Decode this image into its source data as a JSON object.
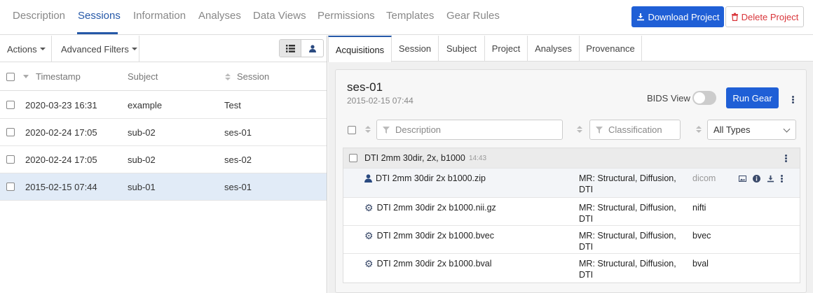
{
  "topnav": {
    "tabs": [
      "Description",
      "Sessions",
      "Information",
      "Analyses",
      "Data Views",
      "Permissions",
      "Templates",
      "Gear Rules"
    ],
    "active_tab": "Sessions",
    "download_label": "Download Project",
    "delete_label": "Delete Project",
    "accent": "#2558a8",
    "primary": "#1f5fd6",
    "danger": "#d9353a"
  },
  "left": {
    "actions_label": "Actions",
    "advanced_filters_label": "Advanced Filters",
    "columns": [
      "Timestamp",
      "Subject",
      "Session"
    ],
    "rows": [
      {
        "timestamp": "2020-03-23 16:31",
        "subject": "example",
        "session": "Test",
        "selected": false
      },
      {
        "timestamp": "2020-02-24 17:05",
        "subject": "sub-02",
        "session": "ses-01",
        "selected": false
      },
      {
        "timestamp": "2020-02-24 17:05",
        "subject": "sub-02",
        "session": "ses-02",
        "selected": false
      },
      {
        "timestamp": "2015-02-15 07:44",
        "subject": "sub-01",
        "session": "ses-01",
        "selected": true
      }
    ]
  },
  "right": {
    "tabs": [
      "Acquisitions",
      "Session",
      "Subject",
      "Project",
      "Analyses",
      "Provenance"
    ],
    "active_tab": "Acquisitions",
    "session_title": "ses-01",
    "session_date": "2015-02-15 07:44",
    "bids_view_label": "BIDS View",
    "bids_view_on": false,
    "run_gear_label": "Run Gear",
    "filters": {
      "description_placeholder": "Description",
      "classification_placeholder": "Classification",
      "type_selected": "All Types"
    },
    "acquisition": {
      "label": "DTI 2mm 30dir, 2x, b1000",
      "time": "14:43"
    },
    "files": [
      {
        "name": "DTI 2mm 30dir 2x b1000.zip",
        "icon": "user-icon",
        "classification_line1": "MR: Structural, Diffusion,",
        "classification_line2": "DTI",
        "type": "dicom"
      },
      {
        "name": "DTI 2mm 30dir 2x b1000.nii.gz",
        "icon": "gear-icon",
        "classification_line1": "MR: Structural, Diffusion,",
        "classification_line2": "DTI",
        "type": "nifti"
      },
      {
        "name": "DTI 2mm 30dir 2x b1000.bvec",
        "icon": "gear-icon",
        "classification_line1": "MR: Structural, Diffusion,",
        "classification_line2": "DTI",
        "type": "bvec"
      },
      {
        "name": "DTI 2mm 30dir 2x b1000.bval",
        "icon": "gear-icon",
        "classification_line1": "MR: Structural, Diffusion,",
        "classification_line2": "DTI",
        "type": "bval"
      }
    ]
  }
}
